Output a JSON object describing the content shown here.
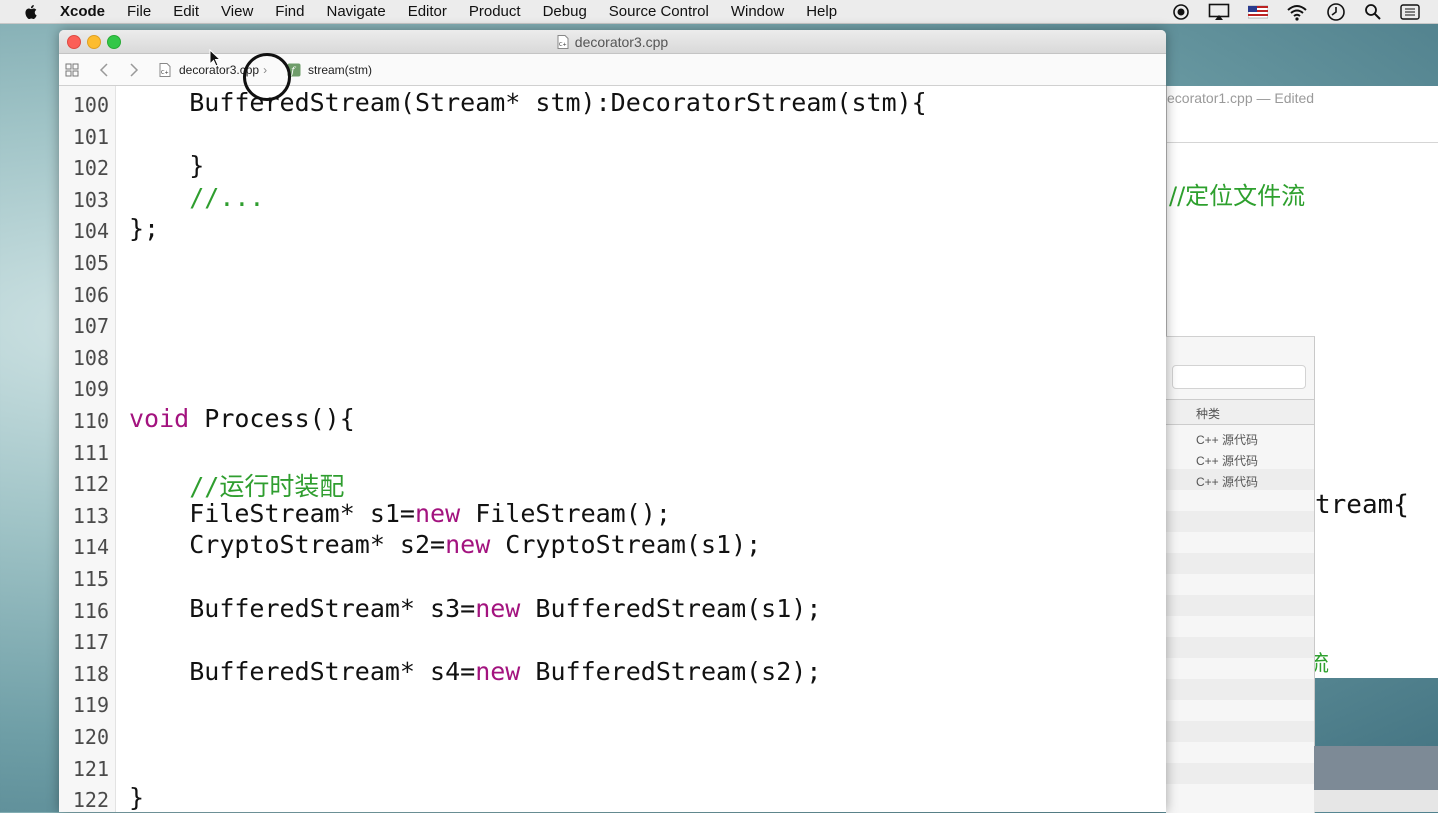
{
  "menubar": {
    "app": "Xcode",
    "items": [
      "File",
      "Edit",
      "View",
      "Find",
      "Navigate",
      "Editor",
      "Product",
      "Debug",
      "Source Control",
      "Window",
      "Help"
    ],
    "status_icons": [
      "record-icon",
      "airplay-icon",
      "flag-icon",
      "wifi-icon",
      "time-machine-icon",
      "spotlight-icon",
      "notification-center-icon"
    ]
  },
  "window": {
    "title": "decorator3.cpp",
    "jump_bar": {
      "file": "decorator3.cpp",
      "symbol": "stream(stm)"
    }
  },
  "code_lines": [
    {
      "n": "100",
      "indent": "    ",
      "text": "BufferedStream(Stream* stm):DecoratorStream(stm){"
    },
    {
      "n": "101",
      "indent": "",
      "text": ""
    },
    {
      "n": "102",
      "indent": "    ",
      "text": "}"
    },
    {
      "n": "103",
      "indent": "    ",
      "comment": "//..."
    },
    {
      "n": "104",
      "indent": "",
      "text": "};"
    },
    {
      "n": "105",
      "indent": "",
      "text": ""
    },
    {
      "n": "106",
      "indent": "",
      "text": ""
    },
    {
      "n": "107",
      "indent": "",
      "text": ""
    },
    {
      "n": "108",
      "indent": "",
      "text": ""
    },
    {
      "n": "109",
      "indent": "",
      "text": ""
    },
    {
      "n": "110",
      "indent": "",
      "kw": "void",
      "text": " Process(){"
    },
    {
      "n": "111",
      "indent": "",
      "text": ""
    },
    {
      "n": "112",
      "indent": "    ",
      "comment": "//运行时装配"
    },
    {
      "n": "113",
      "indent": "    ",
      "pre": "FileStream* s1=",
      "kw": "new",
      "text": " FileStream();"
    },
    {
      "n": "114",
      "indent": "    ",
      "pre": "CryptoStream* s2=",
      "kw": "new",
      "text": " CryptoStream(s1);"
    },
    {
      "n": "115",
      "indent": "",
      "text": ""
    },
    {
      "n": "116",
      "indent": "    ",
      "pre": "BufferedStream* s3=",
      "kw": "new",
      "text": " BufferedStream(s1);"
    },
    {
      "n": "117",
      "indent": "",
      "text": ""
    },
    {
      "n": "118",
      "indent": "    ",
      "pre": "BufferedStream* s4=",
      "kw": "new",
      "text": " BufferedStream(s2);"
    },
    {
      "n": "119",
      "indent": "",
      "text": ""
    },
    {
      "n": "120",
      "indent": "",
      "text": ""
    },
    {
      "n": "121",
      "indent": "",
      "text": ""
    },
    {
      "n": "122",
      "indent": "",
      "text": "}"
    }
  ],
  "background_window": {
    "title": "ecorator1.cpp — Edited",
    "comment": "//定位文件流",
    "code_fragment": "tream{",
    "fragment_glyph": "流"
  },
  "type_panel": {
    "column_header": "种类",
    "rows": [
      "C++ 源代码",
      "C++ 源代码",
      "C++ 源代码"
    ]
  },
  "colors": {
    "keyword": "#a3137f",
    "comment": "#2f9e2f"
  }
}
